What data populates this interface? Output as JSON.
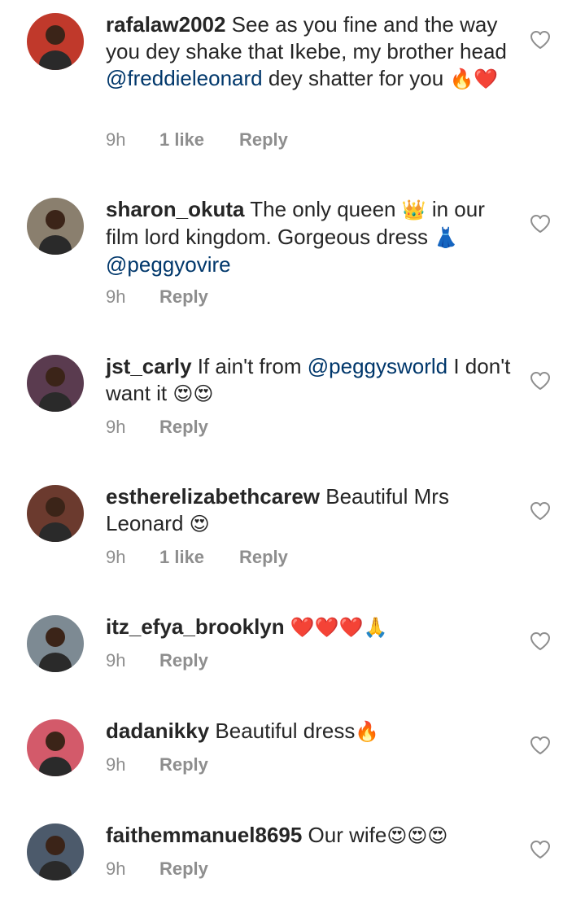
{
  "comments": [
    {
      "username": "rafalaw2002",
      "segments": [
        {
          "type": "text",
          "text": " See as you fine and the way you dey shake that Ikebe, my brother head "
        },
        {
          "type": "mention",
          "text": "@freddieleonard"
        },
        {
          "type": "text",
          "text": " dey shatter for you "
        },
        {
          "type": "emoji",
          "text": "🔥❤️"
        }
      ],
      "time": "9h",
      "likes": "1 like",
      "reply": "Reply",
      "avatar_color": "#c0392b"
    },
    {
      "username": "sharon_okuta",
      "segments": [
        {
          "type": "text",
          "text": " The only queen "
        },
        {
          "type": "emoji",
          "text": "👑"
        },
        {
          "type": "text",
          "text": " in our film lord kingdom. Gorgeous dress "
        },
        {
          "type": "emoji",
          "text": "👗"
        },
        {
          "type": "text",
          "text": " "
        },
        {
          "type": "mention",
          "text": "@peggyovire"
        }
      ],
      "time": "9h",
      "likes": "",
      "reply": "Reply",
      "avatar_color": "#8a7f6e"
    },
    {
      "username": "jst_carly",
      "segments": [
        {
          "type": "text",
          "text": " If ain't from "
        },
        {
          "type": "mention",
          "text": "@peggysworld"
        },
        {
          "type": "text",
          "text": " I don't want it "
        },
        {
          "type": "emoji",
          "text": "😍😍"
        }
      ],
      "time": "9h",
      "likes": "",
      "reply": "Reply",
      "avatar_color": "#5a3b4f"
    },
    {
      "username": "estherelizabethcarew",
      "segments": [
        {
          "type": "text",
          "text": " Beautiful Mrs Leonard "
        },
        {
          "type": "emoji",
          "text": "😍"
        }
      ],
      "time": "9h",
      "likes": "1 like",
      "reply": "Reply",
      "avatar_color": "#6b3a2e"
    },
    {
      "username": "itz_efya_brooklyn",
      "segments": [
        {
          "type": "text",
          "text": " "
        },
        {
          "type": "emoji",
          "text": "❤️❤️❤️🙏"
        }
      ],
      "time": "9h",
      "likes": "",
      "reply": "Reply",
      "avatar_color": "#7d8a93"
    },
    {
      "username": "dadanikky",
      "segments": [
        {
          "type": "text",
          "text": " Beautiful dress"
        },
        {
          "type": "emoji",
          "text": "🔥"
        }
      ],
      "time": "9h",
      "likes": "",
      "reply": "Reply",
      "avatar_color": "#d35a6a"
    },
    {
      "username": "faithemmanuel8695",
      "segments": [
        {
          "type": "text",
          "text": " Our wife"
        },
        {
          "type": "emoji",
          "text": "😍😍😍"
        }
      ],
      "time": "9h",
      "likes": "",
      "reply": "Reply",
      "avatar_color": "#4c5a6b"
    }
  ]
}
